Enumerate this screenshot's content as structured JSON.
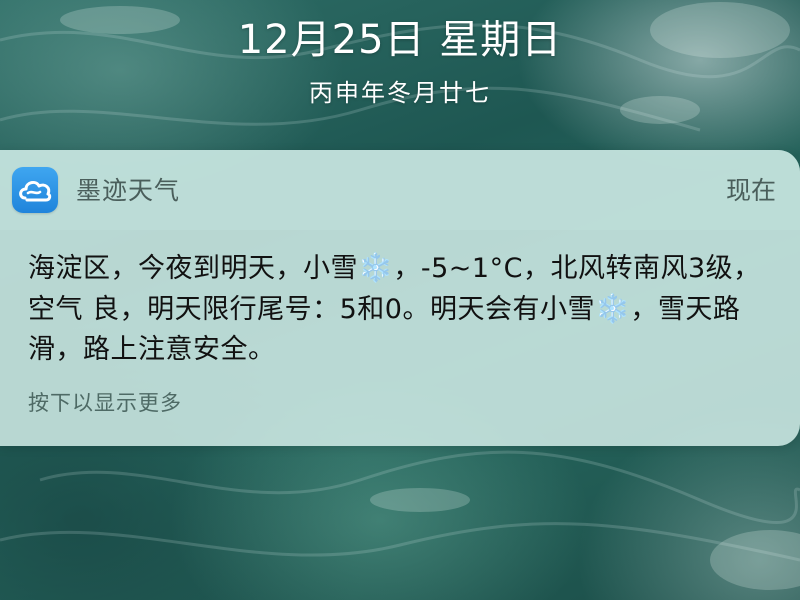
{
  "lockscreen": {
    "date": "12月25日 星期日",
    "lunar_date": "丙申年冬月廿七"
  },
  "notification": {
    "app_icon": "cloud-icon",
    "app_name": "墨迹天气",
    "time": "现在",
    "message_parts": {
      "part1": "海淀区，今夜到明天，小雪",
      "snow_emoji": "❄️",
      "part2": "，-5~1°C，北风转南风3级，空气 良，明天限行尾号：5和0。明天会有小雪",
      "part3": "，雪天路滑，路上注意安全。"
    },
    "more_hint": "按下以显示更多"
  }
}
